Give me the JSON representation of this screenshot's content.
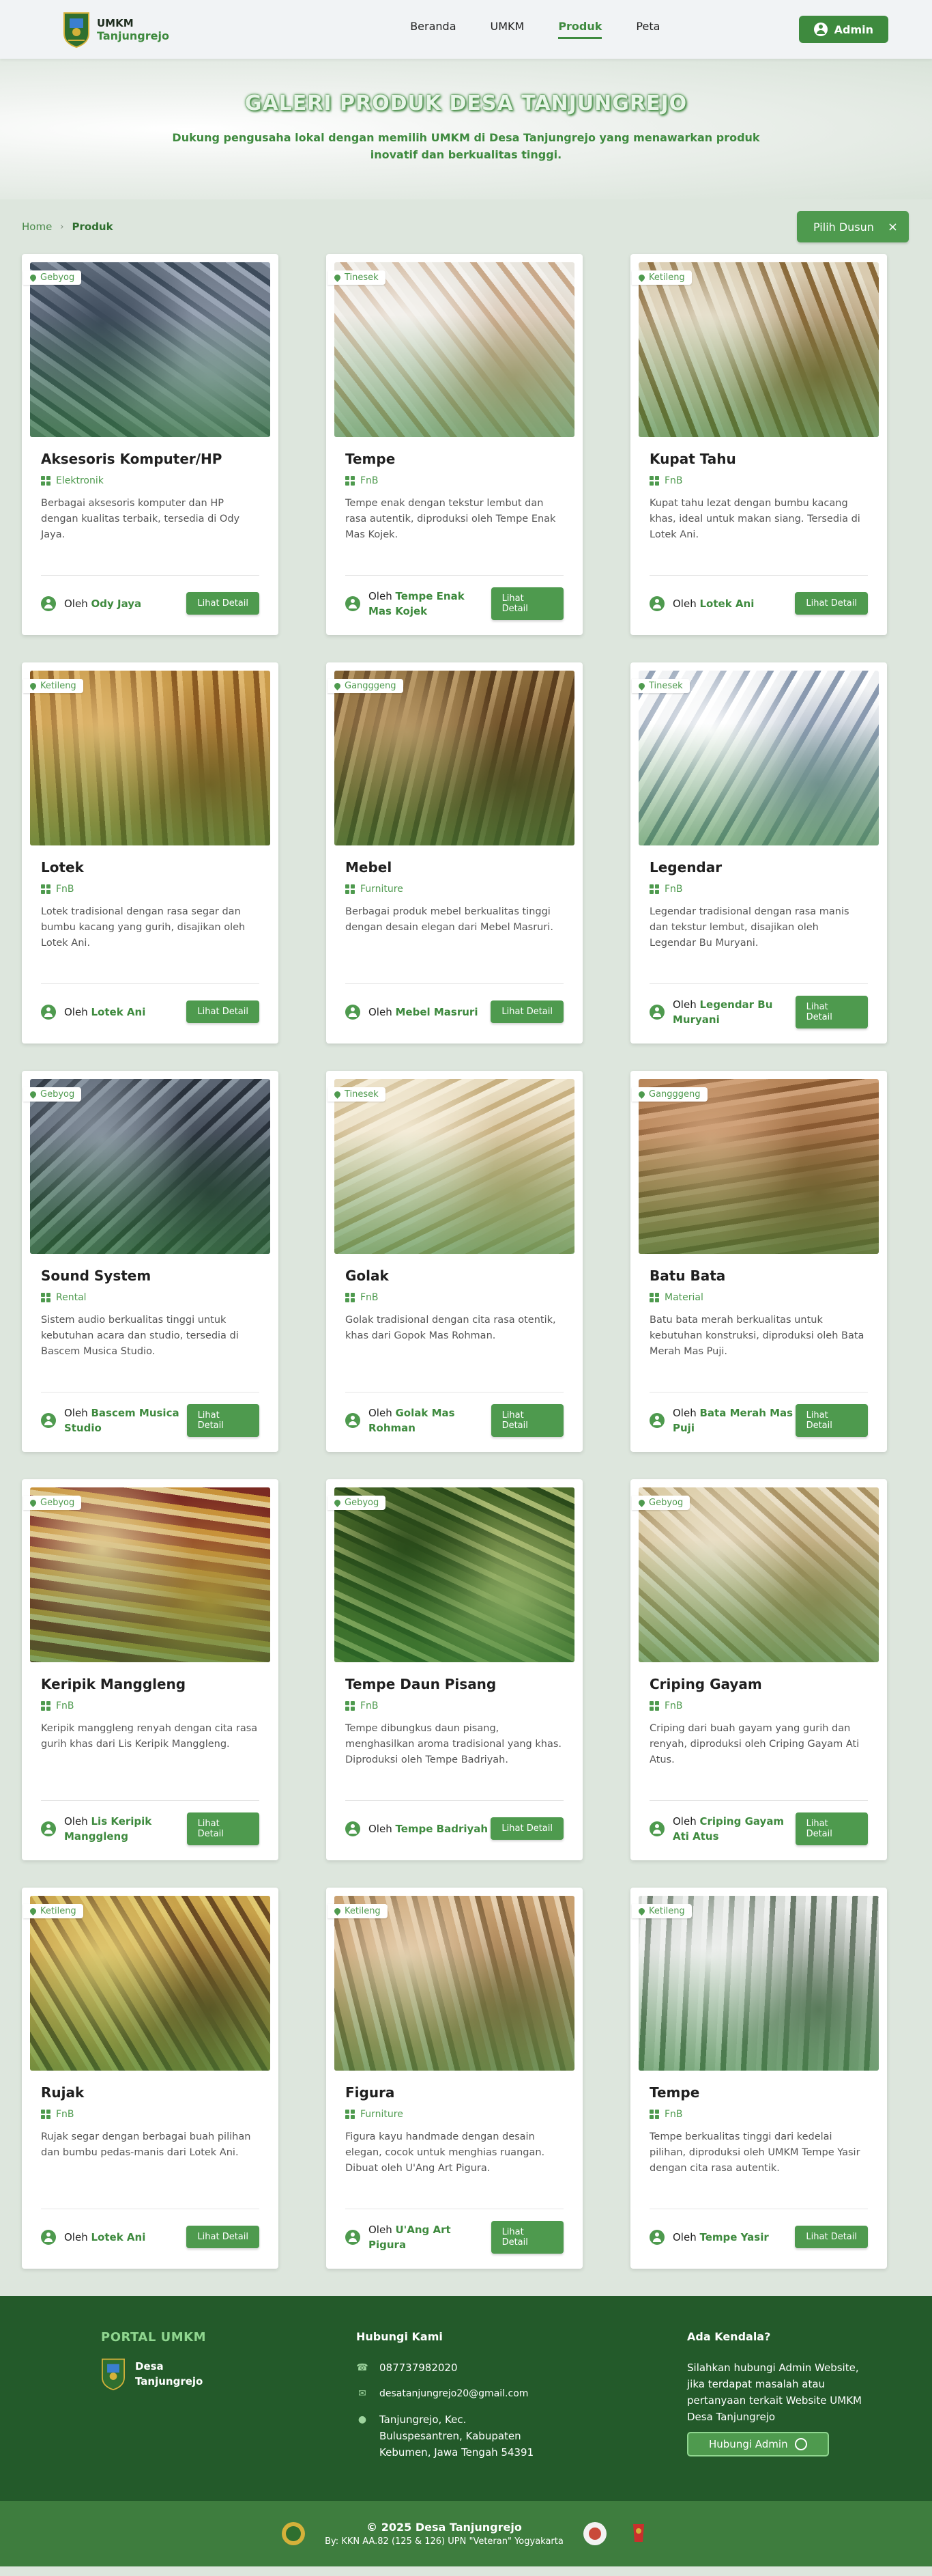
{
  "brand": {
    "line1": "UMKM",
    "line2": "Tanjungrejo"
  },
  "nav": [
    {
      "label": "Beranda",
      "active": false
    },
    {
      "label": "UMKM",
      "active": false
    },
    {
      "label": "Produk",
      "active": true
    },
    {
      "label": "Peta",
      "active": false
    }
  ],
  "admin_label": "Admin",
  "hero": {
    "title": "GALERI PRODUK DESA TANJUNGREJO",
    "subtitle": "Dukung pengusaha lokal dengan memilih UMKM di Desa Tanjungrejo yang menawarkan produk inovatif dan berkualitas tinggi."
  },
  "breadcrumb": {
    "home": "Home",
    "sep": "›",
    "current": "Produk"
  },
  "filter": {
    "label": "Pilih Dusun",
    "clear": "×"
  },
  "by_label": "Oleh",
  "detail_label": "Lihat Detail",
  "products": [
    {
      "title": "Aksesoris Komputer/HP",
      "category": "Elektronik",
      "dusun": "Gebyog",
      "desc": "Berbagai aksesoris komputer dan HP dengan kualitas terbaik, tersedia di Ody Jaya.",
      "owner": "Ody Jaya",
      "img": [
        "#6f7a8a",
        "#9aa5b5",
        "#3c4a5a"
      ]
    },
    {
      "title": "Tempe",
      "category": "FnB",
      "dusun": "Tinesek",
      "desc": "Tempe enak dengan tekstur lembut dan rasa autentik, diproduksi oleh Tempe Enak Mas Kojek.",
      "owner": "Tempe Enak Mas Kojek",
      "img": [
        "#e9e6df",
        "#c9a98a",
        "#f4f2ee"
      ]
    },
    {
      "title": "Kupat Tahu",
      "category": "FnB",
      "dusun": "Ketileng",
      "desc": "Kupat tahu lezat dengan bumbu kacang khas, ideal untuk makan siang. Tersedia di Lotek Ani.",
      "owner": "Lotek Ani",
      "img": [
        "#d9cbb0",
        "#8a6a3a",
        "#e8e2d0"
      ]
    },
    {
      "title": "Lotek",
      "category": "FnB",
      "dusun": "Ketileng",
      "desc": "Lotek tradisional dengan rasa segar dan bumbu kacang yang gurih, disajikan oleh Lotek Ani.",
      "owner": "Lotek Ani",
      "img": [
        "#c89a4a",
        "#8a5a22",
        "#e0b870"
      ]
    },
    {
      "title": "Mebel",
      "category": "Furniture",
      "dusun": "Gangggeng",
      "desc": "Berbagai produk mebel berkualitas tinggi dengan desain elegan dari Mebel Masruri.",
      "owner": "Mebel Masruri",
      "img": [
        "#8a6a3a",
        "#5a3e1e",
        "#b89866"
      ]
    },
    {
      "title": "Legendar",
      "category": "FnB",
      "dusun": "Tinesek",
      "desc": "Legendar tradisional dengan rasa manis dan tekstur lembut, disajikan oleh Legendar Bu Muryani.",
      "owner": "Legendar Bu Muryani",
      "img": [
        "#eef0f2",
        "#8a9ab0",
        "#ffffff"
      ]
    },
    {
      "title": "Sound System",
      "category": "Rental",
      "dusun": "Gebyog",
      "desc": "Sistem audio berkualitas tinggi untuk kebutuhan acara dan studio, tersedia di Bascem Musica Studio.",
      "owner": "Bascem Musica Studio",
      "img": [
        "#5a6472",
        "#2a323c",
        "#8a96a2"
      ]
    },
    {
      "title": "Golak",
      "category": "FnB",
      "dusun": "Tinesek",
      "desc": "Golak tradisional dengan cita rasa otentik, khas dari Gopok Mas Rohman.",
      "owner": "Golak Mas Rohman",
      "img": [
        "#e8dcc0",
        "#c8b080",
        "#f4ecd8"
      ]
    },
    {
      "title": "Batu Bata",
      "category": "Material",
      "dusun": "Gangggeng",
      "desc": "Batu bata merah berkualitas untuk kebutuhan konstruksi, diproduksi oleh Bata Merah Mas Puji.",
      "owner": "Bata Merah Mas Puji",
      "img": [
        "#b8865a",
        "#8a5a32",
        "#d0a27a"
      ]
    },
    {
      "title": "Keripik Manggleng",
      "category": "FnB",
      "dusun": "Gebyog",
      "desc": "Keripik manggleng renyah dengan cita rasa gurih khas dari Lis Keripik Manggleng.",
      "owner": "Lis Keripik Manggleng",
      "img": [
        "#7a2a22",
        "#c8923a",
        "#e0c890"
      ]
    },
    {
      "title": "Tempe Daun Pisang",
      "category": "FnB",
      "dusun": "Gebyog",
      "desc": "Tempe dibungkus daun pisang, menghasilkan aroma tradisional yang khas. Diproduksi oleh Tempe Badriyah.",
      "owner": "Tempe Badriyah",
      "img": [
        "#4a6a2a",
        "#a8b870",
        "#2a4a1a"
      ]
    },
    {
      "title": "Criping Gayam",
      "category": "FnB",
      "dusun": "Gebyog",
      "desc": "Criping dari buah gayam yang gurih dan renyah, diproduksi oleh Criping Gayam Ati Atus.",
      "owner": "Criping Gayam Ati Atus",
      "img": [
        "#d8c8a0",
        "#a89060",
        "#eae0c8"
      ]
    },
    {
      "title": "Rujak",
      "category": "FnB",
      "dusun": "Ketileng",
      "desc": "Rujak segar dengan berbagai buah pilihan dan bumbu pedas-manis dari Lotek Ani.",
      "owner": "Lotek Ani",
      "img": [
        "#c8a24a",
        "#6a4a22",
        "#e0c870"
      ]
    },
    {
      "title": "Figura",
      "category": "Furniture",
      "dusun": "Ketileng",
      "desc": "Figura kayu handmade dengan desain elegan, cocok untuk menghias ruangan. Dibuat oleh U'Ang Art Pigura.",
      "owner": "U'Ang Art Pigura",
      "img": [
        "#c8a070",
        "#8a6a42",
        "#e6d0b0"
      ]
    },
    {
      "title": "Tempe",
      "category": "FnB",
      "dusun": "Ketileng",
      "desc": "Tempe berkualitas tinggi dari kedelai pilihan, diproduksi oleh UMKM Tempe Yasir dengan cita rasa autentik.",
      "owner": "Tempe Yasir",
      "img": [
        "#d8dcd8",
        "#6a7a6a",
        "#eef0ee"
      ]
    }
  ],
  "footer": {
    "portal": "PORTAL UMKM",
    "desa_line1": "Desa",
    "desa_line2": "Tanjungrejo",
    "contact_title": "Hubungi Kami",
    "phone": "087737982020",
    "email": "desatanjungrejo20@gmail.com",
    "address": "Tanjungrejo, Kec. Buluspesantren, Kabupaten Kebumen, Jawa Tengah 54391",
    "help_title": "Ada Kendala?",
    "help_text": "Silahkan hubungi Admin Website, jika terdapat masalah atau pertanyaan terkait Website UMKM Desa Tanjungrejo",
    "help_btn": "Hubungi Admin",
    "copyright": "© 2025 Desa Tanjungrejo",
    "credit": "By: KKN AA.82 (125 & 126) UPN \"Veteran\" Yogyakarta"
  },
  "colors": {
    "primary": "#3e8a3e",
    "footer_bg": "#235a2a",
    "bottom_bg": "#3e7d3e"
  }
}
